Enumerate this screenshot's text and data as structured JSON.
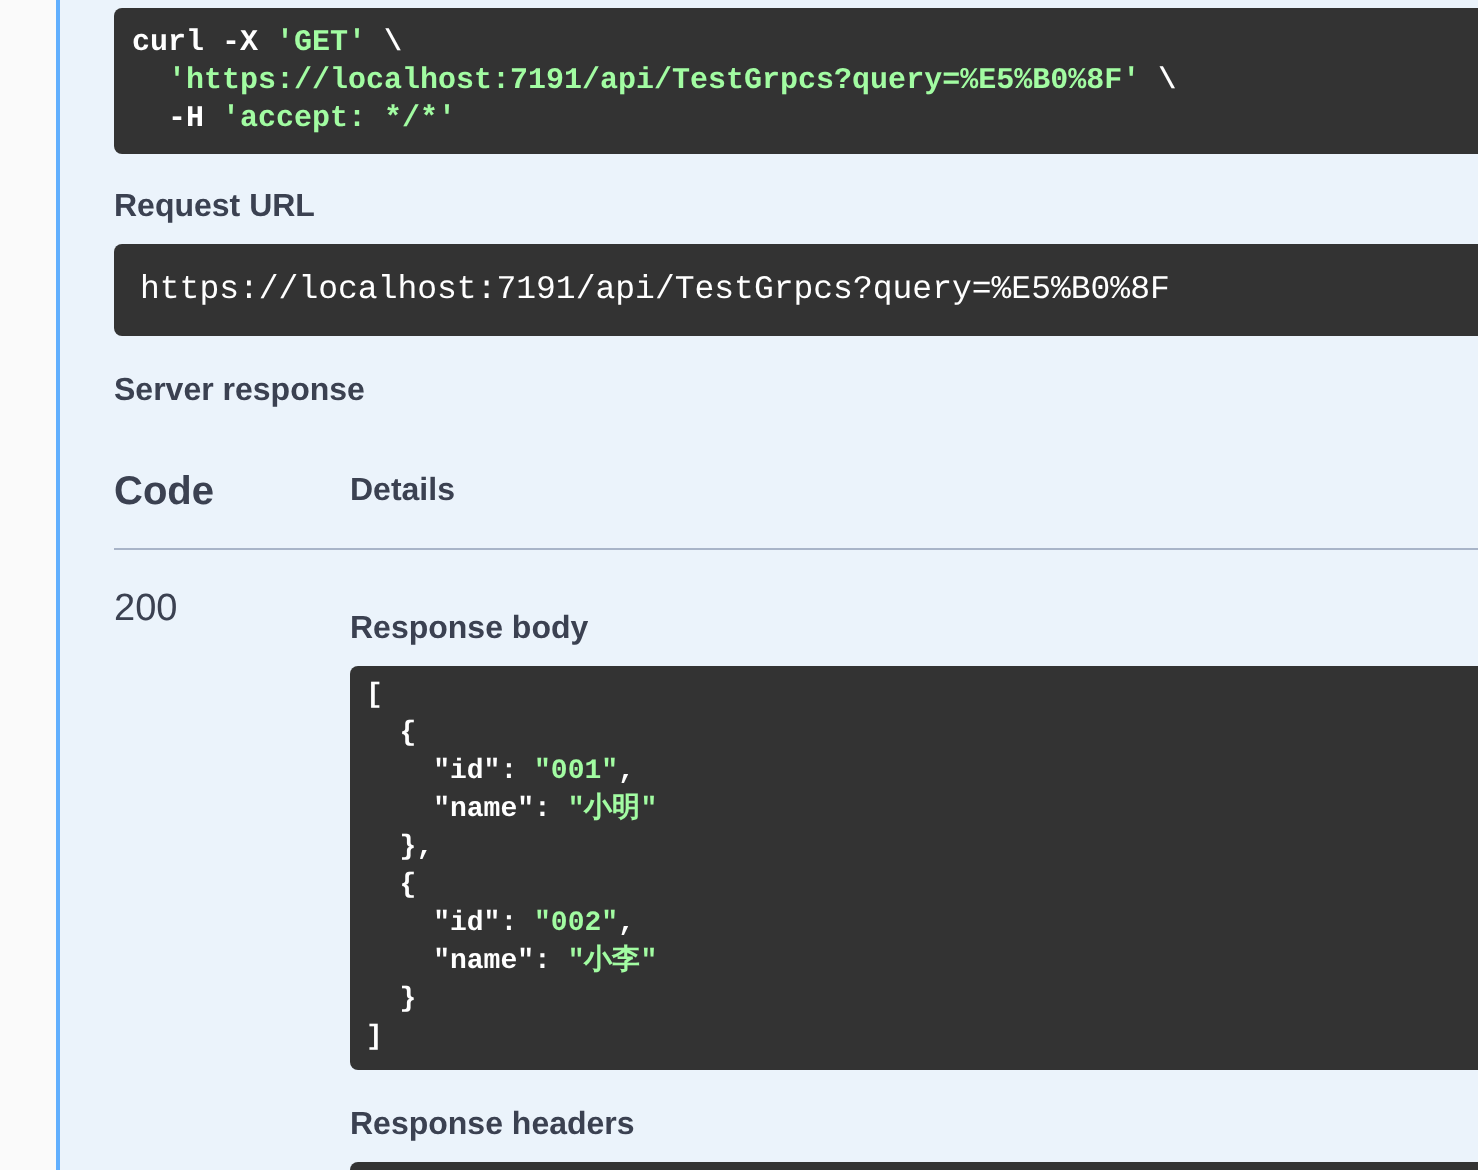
{
  "curl": {
    "lines": [
      [
        {
          "kind": "plain",
          "text": "curl -X "
        },
        {
          "kind": "string",
          "text": "'GET'"
        },
        {
          "kind": "plain",
          "text": " \\"
        }
      ],
      [
        {
          "kind": "string",
          "text": "  'https://localhost:7191/api/TestGrpcs?query=%E5%B0%8F'"
        },
        {
          "kind": "plain",
          "text": " \\"
        }
      ],
      [
        {
          "kind": "plain",
          "text": "  -H "
        },
        {
          "kind": "string",
          "text": "'accept: */*'"
        }
      ]
    ]
  },
  "request_url": {
    "label": "Request URL",
    "value": "https://localhost:7191/api/TestGrpcs?query=%E5%B0%8F"
  },
  "server_response": {
    "label": "Server response",
    "columns": [
      "Code",
      "Details"
    ],
    "rows": [
      {
        "code": "200",
        "body_label": "Response body",
        "body_lines": [
          [
            {
              "kind": "plain",
              "text": "["
            }
          ],
          [
            {
              "kind": "plain",
              "text": "  {"
            }
          ],
          [
            {
              "kind": "plain",
              "text": "    \"id\": "
            },
            {
              "kind": "string",
              "text": "\"001\""
            },
            {
              "kind": "plain",
              "text": ","
            }
          ],
          [
            {
              "kind": "plain",
              "text": "    \"name\": "
            },
            {
              "kind": "string",
              "text": "\"小明\""
            }
          ],
          [
            {
              "kind": "plain",
              "text": "  },"
            }
          ],
          [
            {
              "kind": "plain",
              "text": "  {"
            }
          ],
          [
            {
              "kind": "plain",
              "text": "    \"id\": "
            },
            {
              "kind": "string",
              "text": "\"002\""
            },
            {
              "kind": "plain",
              "text": ","
            }
          ],
          [
            {
              "kind": "plain",
              "text": "    \"name\": "
            },
            {
              "kind": "string",
              "text": "\"小李\""
            }
          ],
          [
            {
              "kind": "plain",
              "text": "  }"
            }
          ],
          [
            {
              "kind": "plain",
              "text": "]"
            }
          ]
        ],
        "headers_label": "Response headers"
      }
    ]
  }
}
